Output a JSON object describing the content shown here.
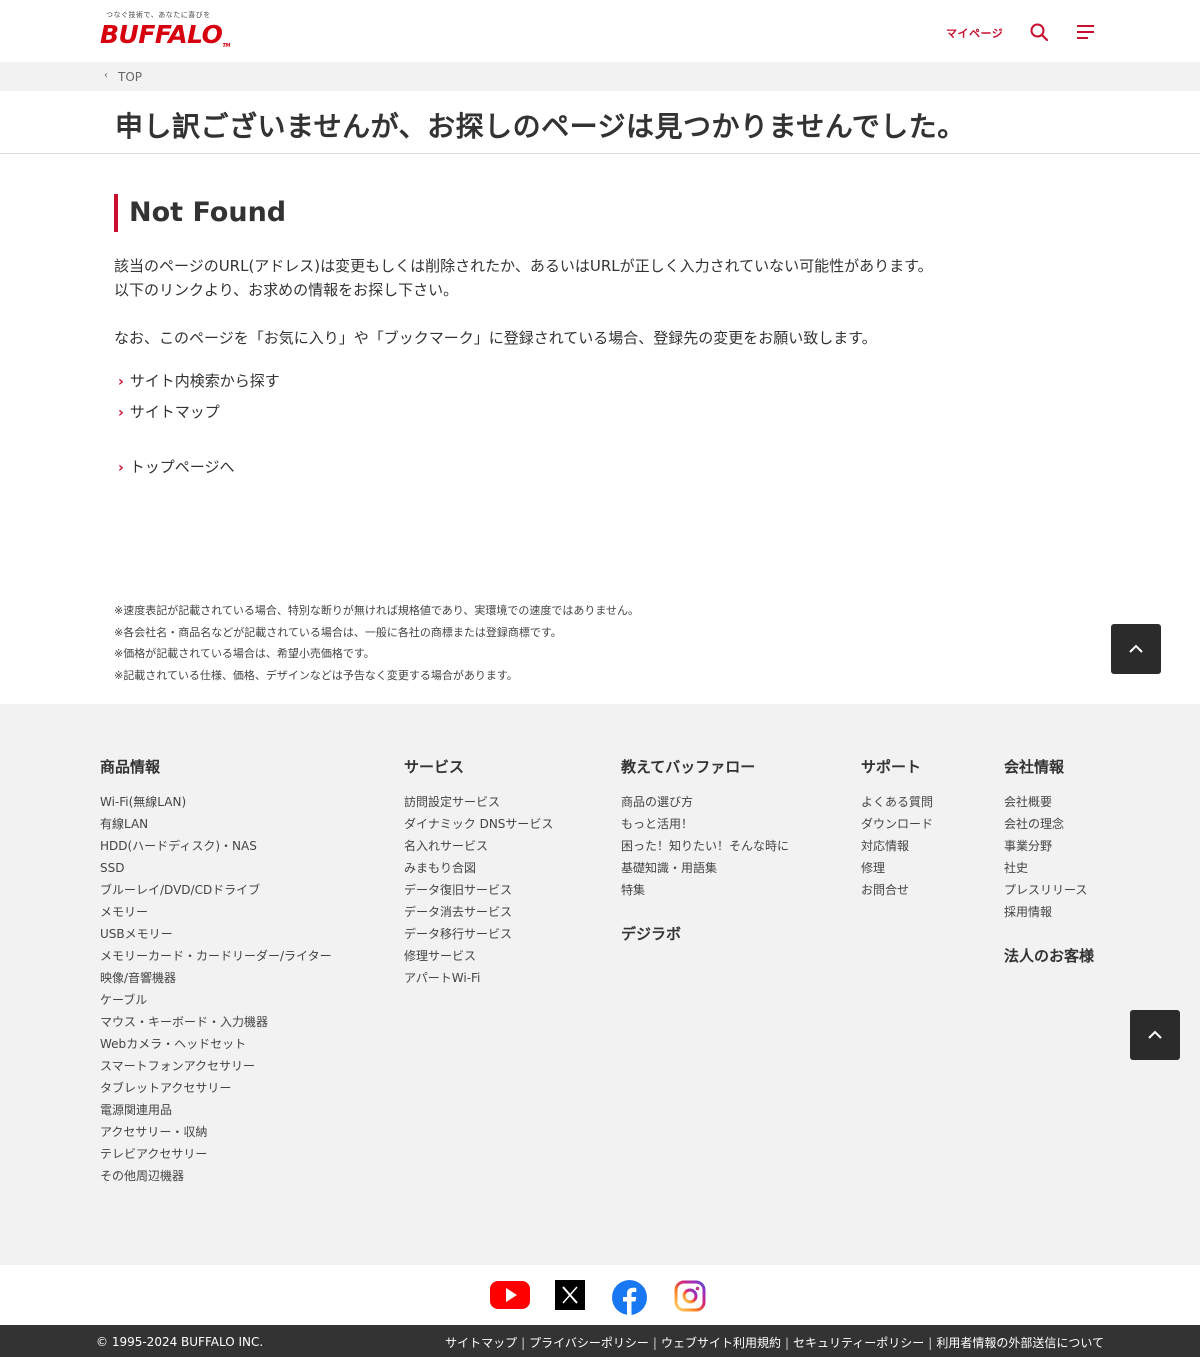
{
  "header": {
    "tagline": "つなぐ技術で、あなたに喜びを",
    "logo_text": "BUFFALO",
    "tm": "TM",
    "mypage_label": "マイページ"
  },
  "breadcrumb": {
    "top_label": "TOP"
  },
  "page_title": "申し訳ございませんが、お探しのページは見つかりませんでした。",
  "main": {
    "heading": "Not Found",
    "para1": "該当のページのURL(アドレス)は変更もしくは削除されたか、あるいはURLが正しく入力されていない可能性があります。",
    "para2": "以下のリンクより、お求めの情報をお探し下さい。",
    "para3": "なお、このページを「お気に入り」や「ブックマーク」に登録されている場合、登録先の変更をお願い致します。",
    "links": [
      "サイト内検索から探す",
      "サイトマップ",
      "トップページへ"
    ]
  },
  "notes": [
    "※速度表記が記載されている場合、特別な断りが無ければ規格値であり、実環境での速度ではありません。",
    "※各会社名・商品名などが記載されている場合は、一般に各社の商標または登録商標です。",
    "※価格が記載されている場合は、希望小売価格です。",
    "※記載されている仕様、価格、デザインなどは予告なく変更する場合があります。"
  ],
  "footer": {
    "products": {
      "title": "商品情報",
      "items": [
        "Wi-Fi(無線LAN)",
        "有線LAN",
        "HDD(ハードディスク)・NAS",
        "SSD",
        "ブルーレイ/DVD/CDドライブ",
        "メモリー",
        "USBメモリー",
        "メモリーカード・カードリーダー/ライター",
        "映像/音響機器",
        "ケーブル",
        "マウス・キーボード・入力機器",
        "Webカメラ・ヘッドセット",
        "スマートフォンアクセサリー",
        "タブレットアクセサリー",
        "電源関連用品",
        "アクセサリー・収納",
        "テレビアクセサリー",
        "その他周辺機器"
      ]
    },
    "services": {
      "title": "サービス",
      "items": [
        "訪問設定サービス",
        "ダイナミック DNSサービス",
        "名入れサービス",
        "みまもり合図",
        "データ復旧サービス",
        "データ消去サービス",
        "データ移行サービス",
        "修理サービス",
        "アパートWi-Fi"
      ]
    },
    "learn": {
      "title": "教えてバッファロー",
      "items": [
        "商品の選び方",
        "もっと活用！",
        "困った！知りたい！そんな時に",
        "基礎知識・用語集",
        "特集"
      ],
      "extra_title": "デジラボ"
    },
    "support": {
      "title": "サポート",
      "items": [
        "よくある質問",
        "ダウンロード",
        "対応情報",
        "修理",
        "お問合せ"
      ]
    },
    "company": {
      "title": "会社情報",
      "items": [
        "会社概要",
        "会社の理念",
        "事業分野",
        "社史",
        "プレスリリース",
        "採用情報"
      ],
      "extra_title": "法人のお客様"
    }
  },
  "social_icons": [
    "youtube-icon",
    "x-icon",
    "facebook-icon",
    "instagram-icon"
  ],
  "bottombar": {
    "copyright": "© 1995-2024 BUFFALO INC.",
    "links": [
      "サイトマップ",
      "プライバシーポリシー",
      "ウェブサイト利用規約",
      "セキュリティーポリシー",
      "利用者情報の外部送信について"
    ]
  },
  "colors": {
    "brand_red": "#c8102e",
    "logo_red": "#d7000f",
    "dark": "#333333",
    "footer_bg": "#f2f2f2"
  }
}
